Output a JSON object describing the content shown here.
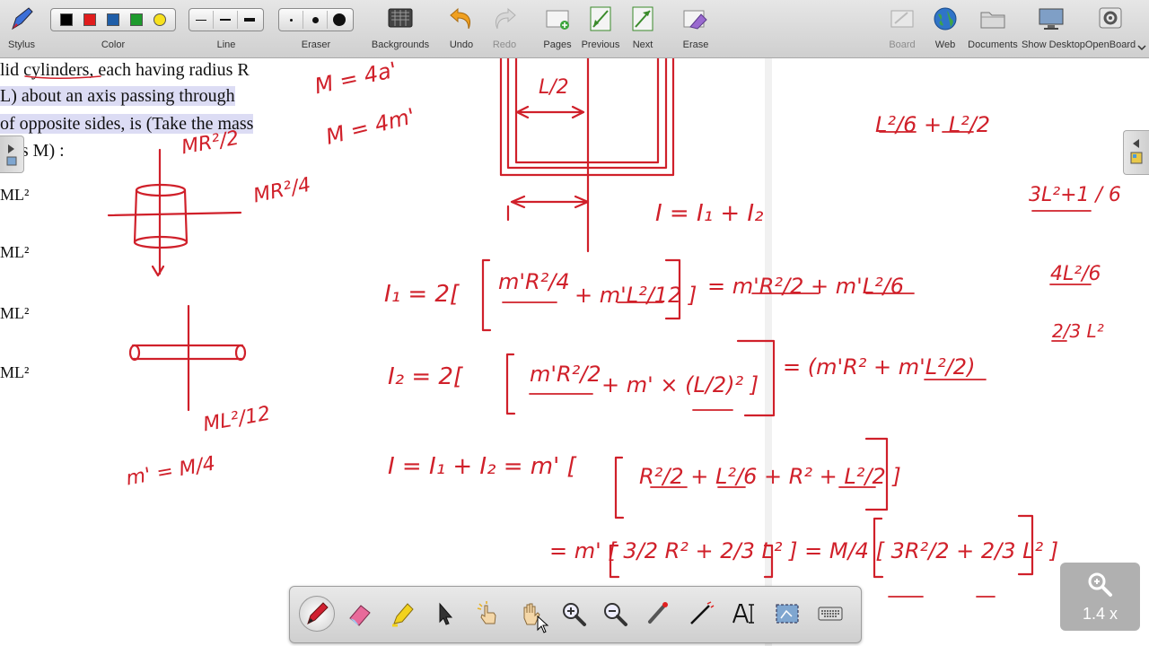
{
  "toolbar": {
    "stylus": "Stylus",
    "color": "Color",
    "line": "Line",
    "eraser": "Eraser",
    "backgrounds": "Backgrounds",
    "undo": "Undo",
    "redo": "Redo",
    "pages": "Pages",
    "previous": "Previous",
    "next": "Next",
    "erase": "Erase",
    "board": "Board",
    "web": "Web",
    "documents": "Documents",
    "show_desktop": "Show Desktop",
    "openboard": "OpenBoard",
    "colors": [
      "#000000",
      "#e01c1c",
      "#1f5ea8",
      "#1e9a2d",
      "#f7e11e"
    ]
  },
  "document": {
    "line1": "lid cylinders, each having radius R",
    "line2": "L) about an axis passing through",
    "line3": "of opposite sides, is (Take the mass",
    "line4": "p as M) :",
    "opt1": "ML²",
    "opt2": "ML²",
    "opt3": "ML²",
    "opt4": "ML²"
  },
  "ink": {
    "m_eq_1": "M = 4a'",
    "m_eq_2": "M = 4m'",
    "mr2_over_2": "MR²/2",
    "mr2_over_4": "MR²/4",
    "ml2_over_12": "ML²/12",
    "m_prime": "m' = M/4",
    "l_half": "L/2",
    "i_sum": "I = I₁ + I₂",
    "i1_lhs": "I₁ = 2[",
    "i1_t1": "m'R²/4",
    "i1_t2": "+ m'L²/12 ]",
    "i1_rhs": "= m'R²/2 + m'L²/6",
    "i2_lhs": "I₂ = 2[",
    "i2_t1": "m'R²/2",
    "i2_t2": "+ m' × (L/2)² ]",
    "i2_rhs": "= (m'R² + m'L²/2)",
    "i_total_lhs": "I = I₁ + I₂ = m' [",
    "i_total_t": "R²/2 + L²/6 + R² + L²/2 ]",
    "final": "= m' [ 3/2 R² + 2/3 L² ] = M/4 [ 3R²/2 + 2/3 L² ]",
    "side1": "L²/6 + L²/2",
    "side2": "3L²+1 / 6",
    "side3": "4L²/6",
    "side4": "2/3 L²"
  },
  "zoom": {
    "label": "1.4 x"
  }
}
